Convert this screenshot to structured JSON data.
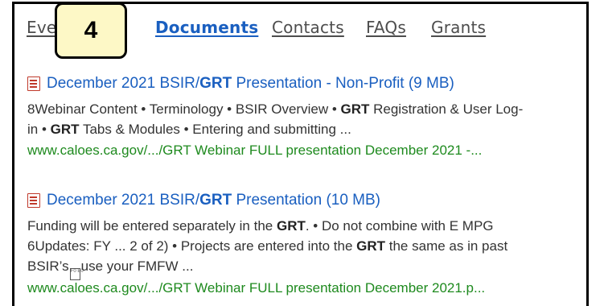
{
  "tabs": [
    {
      "label": "Ever",
      "active": false
    },
    {
      "label": "Documents",
      "active": true
    },
    {
      "label": "Contacts",
      "active": false
    },
    {
      "label": "FAQs",
      "active": false
    },
    {
      "label": "Grants",
      "active": false
    }
  ],
  "step_badge": {
    "label": "4"
  },
  "results": [
    {
      "icon": "pdf-file-icon",
      "title_pre": "December 2021 BSIR/",
      "title_bold": "GRT",
      "title_post": " Presentation - Non-Profit (9 MB)",
      "line1_a": "8Webinar Content • Terminology • BSIR Overview • ",
      "line1_b": "GRT",
      "line1_c": " Registration & User Log-",
      "line2_a": "in • ",
      "line2_b": "GRT",
      "line2_c": " Tabs & Modules • Entering and submitting ...",
      "url": "www.caloes.ca.gov/.../GRT Webinar FULL presentation December 2021 -..."
    },
    {
      "icon": "pdf-file-icon",
      "title_pre": "December 2021 BSIR/",
      "title_bold": "GRT",
      "title_post": " Presentation (10 MB)",
      "line1_a": "Funding will be entered separately in the ",
      "line1_b": "GRT",
      "line1_c": ". • Do not combine with E MPG",
      "line2_a": "6Updates: FY ... 2 of 2) • Projects are entered into the ",
      "line2_b": "GRT",
      "line2_c": " the same as in past",
      "line3_a": "BSIR’s",
      "line3_glyph": "F0 E0",
      "line3_b": "use your FMFW ...",
      "url": "www.caloes.ca.gov/.../GRT Webinar FULL presentation December 2021.p..."
    }
  ]
}
